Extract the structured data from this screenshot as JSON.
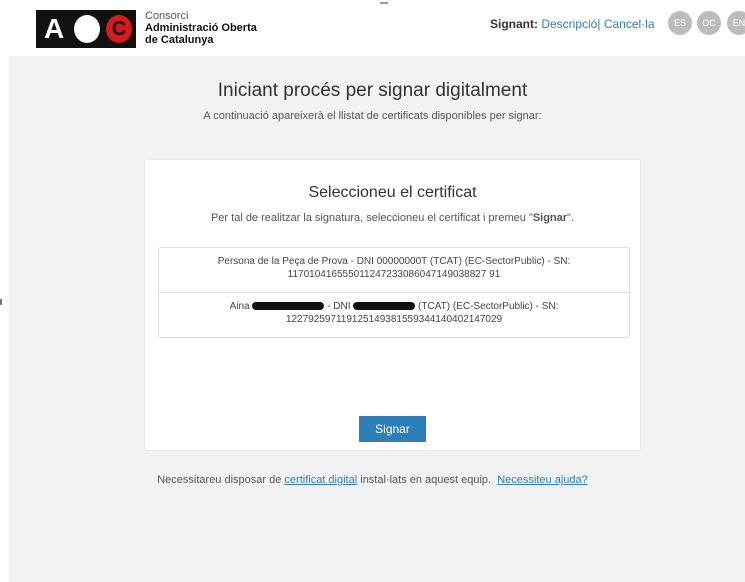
{
  "header": {
    "org_line1": "Consorci",
    "org_line2": "Administració Oberta",
    "org_line3": "de Catalunya",
    "logo_text": "AOC",
    "signant_label": "Signant:",
    "signant_description": "Descripció",
    "signant_separator": "|",
    "signant_cancel": "Cancel·la",
    "languages": [
      "ES",
      "OC",
      "EN"
    ]
  },
  "main": {
    "title": "Iniciant procés per signar digitalment",
    "subtitle": "A continuació apareixerà el llistat de certificats disponibles per signar:"
  },
  "card": {
    "title": "Seleccioneu el certificat",
    "instructions_pre": "Per tal de realitzar la signatura, seleccioneu el certificat i premeu \"",
    "instructions_bold": "Signar",
    "instructions_post": "\".",
    "certificates": [
      {
        "line1": "Persona de la Peça de Prova - DNI 00000000T (TCAT) (EC-SectorPublic) - SN:",
        "line2": "117010416555011247233086047149038827 91"
      },
      {
        "line1_pre": "Aina",
        "line1_mid": "- DNI",
        "line1_post": "(TCAT) (EC-SectorPublic) - SN:",
        "line2": "122792597119125149381559344140402147029"
      }
    ],
    "sign_button": "Signar"
  },
  "footer": {
    "text_pre": "Necessitareu disposar de ",
    "link_certificat": "certificat digital",
    "text_mid": " instal·lats en aquest equip.",
    "link_help": "Necessiteu ajuda?"
  }
}
